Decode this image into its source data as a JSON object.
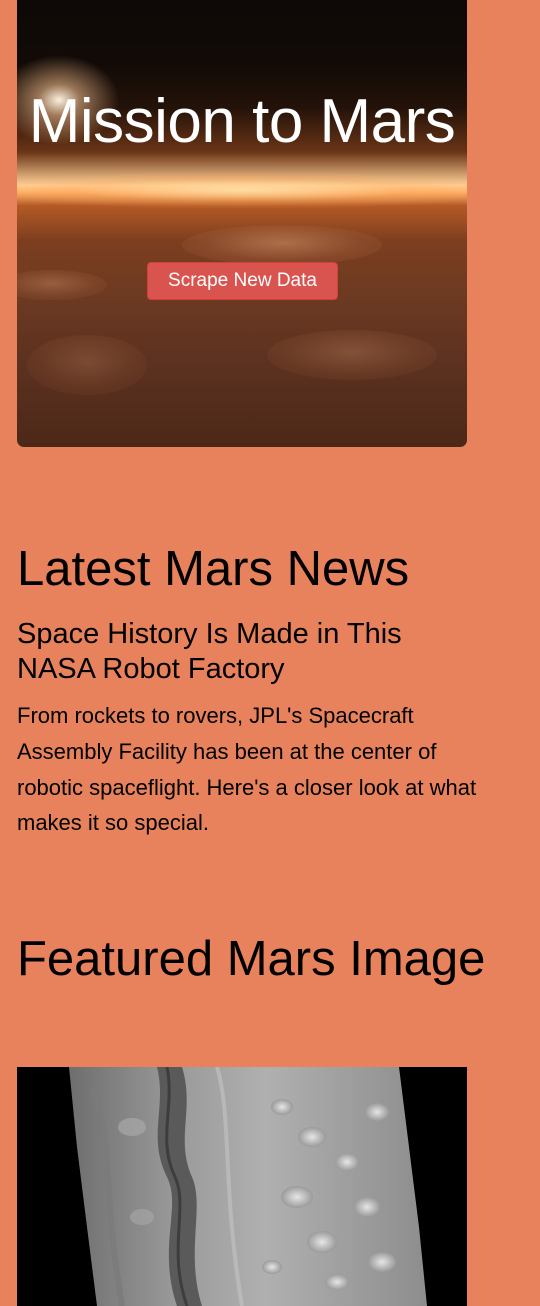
{
  "hero": {
    "title": "Mission to Mars",
    "scrape_button_label": "Scrape New Data"
  },
  "news": {
    "section_heading": "Latest Mars News",
    "title": "Space History Is Made in This NASA Robot Factory",
    "paragraph": "From rockets to rovers, JPL's Spacecraft Assembly Facility has been at the center of robotic spaceflight. Here's a closer look at what makes it so special."
  },
  "featured_image": {
    "section_heading": "Featured Mars Image"
  },
  "colors": {
    "page_background": "#E8825C",
    "button_background": "#d9534f",
    "hero_title": "#ffffff"
  }
}
